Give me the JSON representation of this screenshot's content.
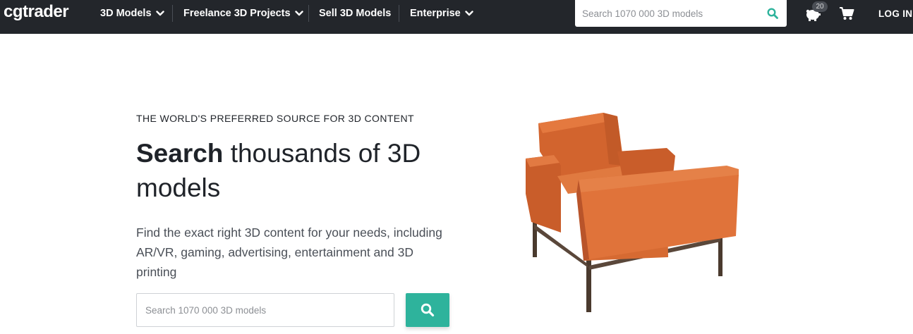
{
  "nav": {
    "logo": "cgtrader",
    "items": [
      {
        "label": "3D Models",
        "has_dropdown": true
      },
      {
        "label": "Freelance 3D Projects",
        "has_dropdown": true
      },
      {
        "label": "Sell 3D Models",
        "has_dropdown": false
      },
      {
        "label": "Enterprise",
        "has_dropdown": true
      }
    ],
    "search_placeholder": "Search 1070 000 3D models",
    "notification_count": "20",
    "login_label": "LOG IN"
  },
  "hero": {
    "eyebrow": "THE WORLD'S PREFERRED SOURCE FOR 3D CONTENT",
    "headline_bold": "Search",
    "headline_rest": " thousands of 3D models",
    "lead": "Find the exact right 3D content for your needs, including AR/VR, gaming, advertising, entertainment and 3D printing",
    "search_placeholder": "Search 1070 000 3D models"
  },
  "icons": {
    "nav_search": "search-icon",
    "hero_search": "search-icon",
    "dropdown": "chevron-down-icon",
    "rewards": "piggy-bank-icon",
    "cart": "shopping-cart-icon"
  },
  "colors": {
    "nav_bg": "#23262b",
    "accent": "#2eb39c",
    "chair": "#e0733a"
  }
}
